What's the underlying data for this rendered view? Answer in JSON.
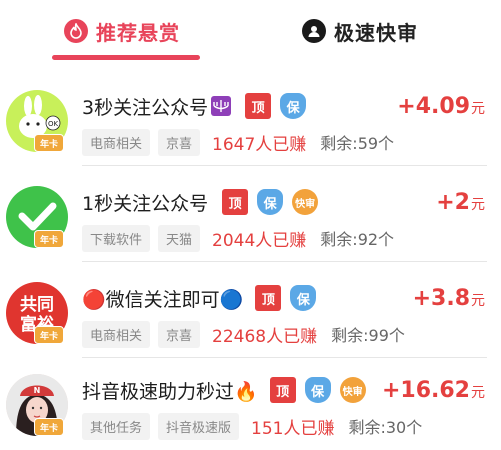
{
  "tabs": {
    "recommended": "推荐悬赏",
    "fast_review": "极速快审"
  },
  "badges": {
    "top": "顶",
    "guarantee": "保",
    "fast": "快审",
    "annual_card": "年卡"
  },
  "tasks": [
    {
      "title": "3秒关注公众号",
      "emoji": "menorah-icon",
      "reward": "+4.09",
      "unit": "元",
      "tags": [
        "电商相关",
        "京喜"
      ],
      "earned": "1647人已赚",
      "remain": "剩余:59个",
      "avatar": "ok-rabbit",
      "avatar_text": "OK"
    },
    {
      "title": "1秒关注公众号",
      "emoji": "",
      "reward": "+2",
      "unit": "元",
      "tags": [
        "下载软件",
        "天猫"
      ],
      "earned": "2044人已赚",
      "remain": "剩余:92个",
      "avatar": "green-check"
    },
    {
      "title": "🔴微信关注即可🔵",
      "emoji": "",
      "reward": "+3.8",
      "unit": "元",
      "tags": [
        "电商相关",
        "京喜"
      ],
      "earned": "22468人已赚",
      "remain": "剩余:99个",
      "avatar": "red-text",
      "avatar_text_1": "共同",
      "avatar_text_2": "富裕"
    },
    {
      "title": "抖音极速助力秒过🔥",
      "emoji": "",
      "reward": "+16.62",
      "unit": "元",
      "tags": [
        "其他任务",
        "抖音极速版"
      ],
      "earned": "151人已赚",
      "remain": "剩余:30个",
      "avatar": "portrait"
    }
  ],
  "colors": {
    "accent": "#e8445a",
    "reward_red": "#e4403f",
    "shield_blue": "#5ba8e6",
    "fast_orange": "#f2a23b",
    "avatar_green": "#3fc24a"
  }
}
